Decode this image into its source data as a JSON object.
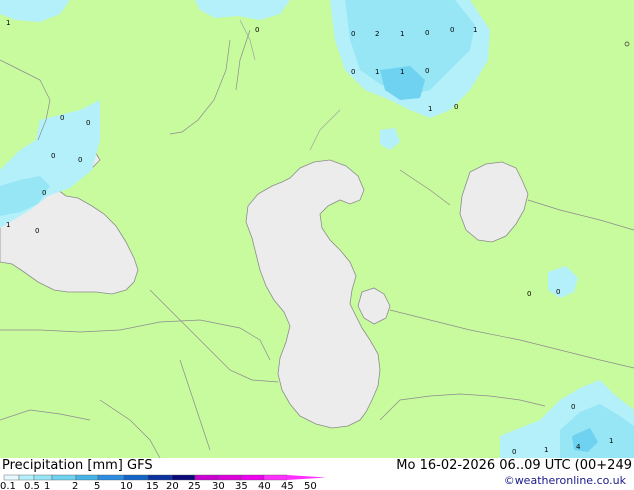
{
  "header": {
    "title_prefix": "Precipitation [mm]",
    "model": "GFS",
    "valid_time": "Mo 16-02-2026 06..09 UTC (00+249"
  },
  "copyright": "©weatheronline.co.uk",
  "legend": {
    "ticks": [
      "0.1",
      "0.5",
      "1",
      "2",
      "5",
      "10",
      "15",
      "20",
      "25",
      "30",
      "35",
      "40",
      "45",
      "50"
    ],
    "colors": [
      "#e8f8ff",
      "#b4f0fa",
      "#96e6f5",
      "#6ed2f0",
      "#46b4e6",
      "#2b8ce1",
      "#1464c8",
      "#0a32a0",
      "#0a0a78",
      "#c800d2",
      "#dc00dc",
      "#f000f0",
      "#ff30ff"
    ]
  },
  "map_colors": {
    "land": "#c8fa9e",
    "water": "#ececec",
    "border": "#8c8c8c"
  },
  "point_values": [
    "1",
    "0",
    "0",
    "2",
    "1",
    "0",
    "0",
    "1",
    "0",
    "1",
    "1",
    "0",
    "1",
    "0",
    "0",
    "0",
    "0",
    "0",
    "0",
    "0",
    "1",
    "0",
    "0",
    "0",
    "0",
    "1",
    "4",
    "1"
  ]
}
